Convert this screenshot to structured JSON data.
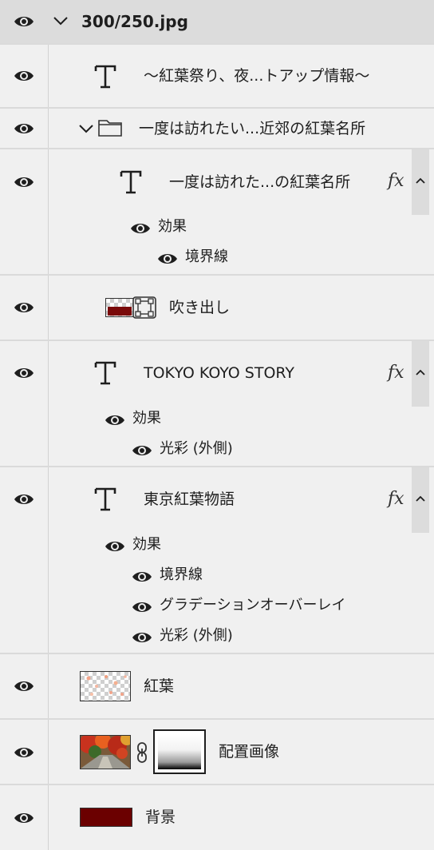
{
  "header": {
    "title": "300/250.jpg"
  },
  "layers": {
    "text_event": {
      "name": "〜紅葉祭り、夜...トアップ情報〜"
    },
    "group": {
      "name": "一度は訪れたい...近郊の紅葉名所"
    },
    "text_group_title": {
      "name": "一度は訪れた...の紅葉名所",
      "fx": "fx",
      "effects_label": "効果",
      "effects": [
        "境界線"
      ]
    },
    "bubble": {
      "name": "吹き出し"
    },
    "text_story": {
      "name": "TOKYO KOYO STORY",
      "fx": "fx",
      "effects_label": "効果",
      "effects": [
        "光彩 (外側)"
      ]
    },
    "text_monogatari": {
      "name": "東京紅葉物語",
      "fx": "fx",
      "effects_label": "効果",
      "effects": [
        "境界線",
        "グラデーションオーバーレイ",
        "光彩 (外側)"
      ]
    },
    "kouyou": {
      "name": "紅葉"
    },
    "placed_image": {
      "name": "配置画像"
    },
    "background": {
      "name": "背景",
      "color": "#6b0000"
    }
  },
  "colors": {
    "panel_bg": "#f0f0f0",
    "header_bg": "#dcdcdc",
    "separator": "#dadada",
    "bubble_fill": "#7a0a0a"
  },
  "icons": {
    "visibility": "eye-icon",
    "text_layer": "text-layer-icon",
    "folder": "folder-icon",
    "expand": "chevron-down-icon",
    "collapse": "chevron-up-icon",
    "link": "link-icon",
    "shape": "shape-transform-icon"
  }
}
